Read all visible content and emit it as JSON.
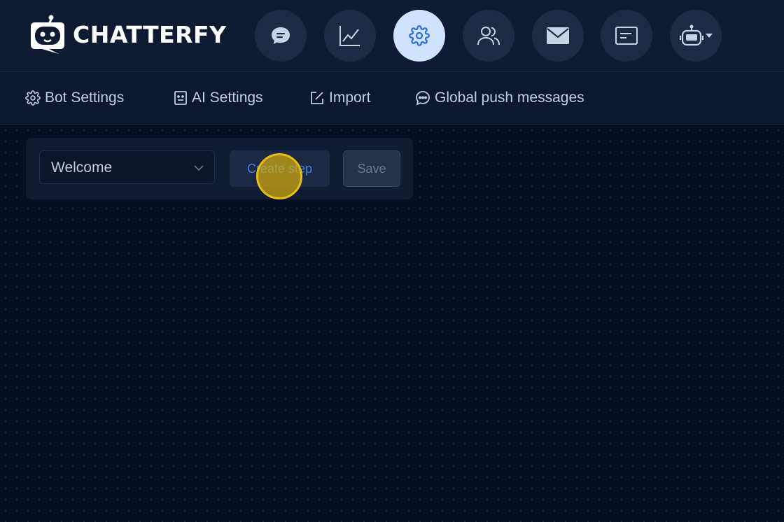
{
  "brand": {
    "name": "CHATTERFY"
  },
  "nav": [
    {
      "name": "messages",
      "icon": "chat-bubble-icon"
    },
    {
      "name": "analytics",
      "icon": "line-chart-icon"
    },
    {
      "name": "settings",
      "icon": "gear-icon",
      "active": true
    },
    {
      "name": "users",
      "icon": "users-icon"
    },
    {
      "name": "mail",
      "icon": "envelope-icon"
    },
    {
      "name": "broadcasts",
      "icon": "message-card-icon"
    },
    {
      "name": "bot-menu",
      "icon": "robot-icon"
    }
  ],
  "subnav": {
    "bot_settings": "Bot Settings",
    "ai_settings": "AI Settings",
    "import": "Import",
    "global_push": "Global push messages"
  },
  "toolbar": {
    "step_select_value": "Welcome",
    "create_step_label": "Create step",
    "save_label": "Save"
  },
  "colors": {
    "background": "#050e22",
    "topbar": "#0f1b33",
    "active_nav": "#cfe3fd",
    "accent": "#3f84e5",
    "cursor_highlight": "#e8bd14"
  }
}
